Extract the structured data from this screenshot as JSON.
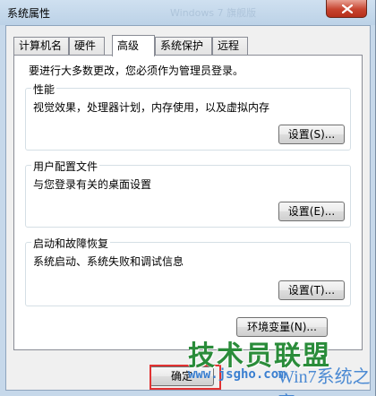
{
  "window": {
    "title": "系统属性",
    "ghost_title": "Windows 7 旗舰版"
  },
  "tabs": [
    {
      "label": "计算机名"
    },
    {
      "label": "硬件"
    },
    {
      "label": "高级",
      "active": true
    },
    {
      "label": "系统保护"
    },
    {
      "label": "远程"
    }
  ],
  "notice": "要进行大多数更改，您必须作为管理员登录。",
  "groups": {
    "performance": {
      "title": "性能",
      "description": "视觉效果，处理器计划，内存使用，以及虚拟内存",
      "button": "设置(S)..."
    },
    "user_profiles": {
      "title": "用户配置文件",
      "description": "与您登录有关的桌面设置",
      "button": "设置(E)..."
    },
    "startup_recovery": {
      "title": "启动和故障恢复",
      "description": "系统启动、系统失败和调试信息",
      "button": "设置(T)..."
    }
  },
  "env_button": "环境变量(N)...",
  "ok_button": "确定",
  "watermark": {
    "title": "技术员联盟",
    "url": "www.jsgho.com",
    "logo": "Win7系统之家"
  },
  "colors": {
    "highlight_border": "#e13232",
    "watermark_green": "#2a8c3a",
    "watermark_blue": "#3a7fd0"
  }
}
